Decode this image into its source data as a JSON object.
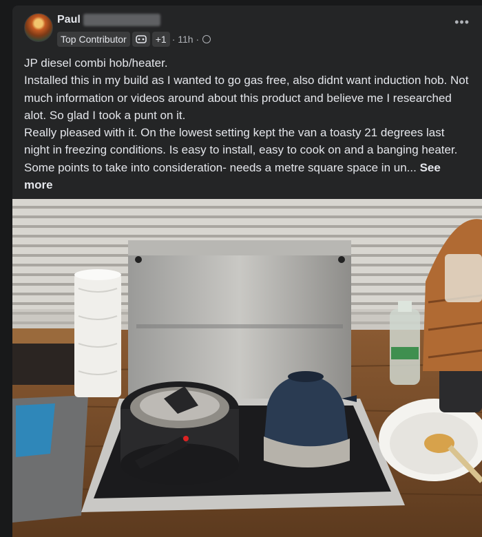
{
  "post": {
    "author": "Paul",
    "badge": "Top Contributor",
    "extra_badges": "+1",
    "time": "· 11h ·",
    "more_icon": "more-horizontal-icon",
    "lines": [
      "JP diesel combi hob/heater.",
      "Installed this in my build as I wanted to go gas free, also didnt want induction hob. Not much information or videos around about this product and believe me I researched alot. So glad I took a punt on it.",
      "Really pleased with it. On the lowest setting kept the van a toasty 21 degrees last night in freezing conditions. Is easy to install, easy to cook on and a banging heater. Some points to take into consideration- needs a metre square space in un..."
    ],
    "see_more": "See more"
  },
  "colors": {
    "background": "#18191a",
    "card": "#242526",
    "text": "#e4e6eb",
    "secondary": "#b0b3b8"
  }
}
